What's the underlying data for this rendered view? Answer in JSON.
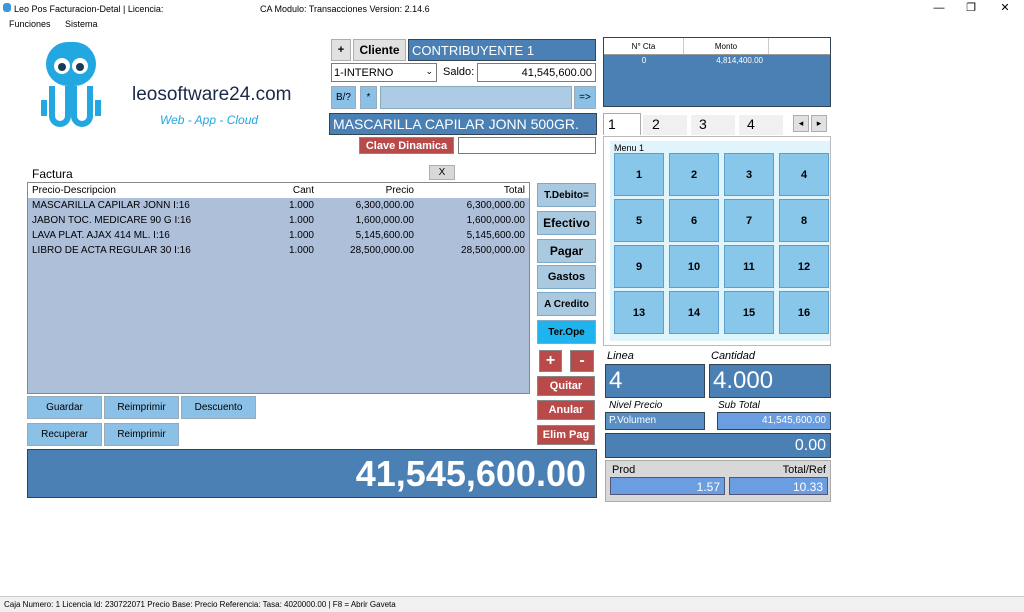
{
  "window": {
    "title": "Leo Pos Facturacion-Detal | Licencia:",
    "module": "CA Modulo: Transacciones Version:  2.14.6",
    "minimize": "—",
    "restore": "❐",
    "close": "✕"
  },
  "menu": [
    "Funciones",
    "Sistema"
  ],
  "logo": {
    "name": "leosoftware24.com",
    "tagline": "Web - App - Cloud"
  },
  "client": {
    "add_label": "+",
    "cliente_label": "Cliente",
    "name": "CONTRIBUYENTE 1",
    "type_selected": "1-INTERNO",
    "saldo_label": "Saldo:",
    "saldo_value": "41,545,600.00",
    "b_label": "B/?",
    "star_label": "*",
    "arrow_label": "=>",
    "product_display": "MASCARILLA CAPILAR JONN 500GR.",
    "clave_label": "Clave Dinamica"
  },
  "mini_table": {
    "headers": [
      "N° Cta",
      "Monto"
    ],
    "rows": [
      [
        "0",
        "4,814,400.00"
      ]
    ]
  },
  "tabs": [
    "1",
    "2",
    "3",
    "4"
  ],
  "tab_nav": {
    "prev": "◂",
    "next": "▸"
  },
  "menu_panel": {
    "title": "Menu 1",
    "buttons": [
      "1",
      "2",
      "3",
      "4",
      "5",
      "6",
      "7",
      "8",
      "9",
      "10",
      "11",
      "12",
      "13",
      "14",
      "15",
      "16"
    ]
  },
  "invoice": {
    "title": "Factura",
    "close_label": "X",
    "headers": [
      "Precio-Descripcion",
      "Cant",
      "Precio",
      "Total"
    ],
    "rows": [
      [
        "MASCARILLA CAPILAR JONN  I:16",
        "1.000",
        "6,300,000.00",
        "6,300,000.00"
      ],
      [
        "JABON TOC. MEDICARE 90 G I:16",
        "1.000",
        "1,600,000.00",
        "1,600,000.00"
      ],
      [
        "LAVA PLAT. AJAX 414 ML. I:16",
        "1.000",
        "5,145,600.00",
        "5,145,600.00"
      ],
      [
        "LIBRO DE ACTA REGULAR 30 I:16",
        "1.000",
        "28,500,000.00",
        "28,500,000.00"
      ]
    ]
  },
  "side_buttons": [
    "T.Debito=",
    "Efectivo",
    "Pagar",
    "Gastos",
    "A Credito",
    "Ter.Ope"
  ],
  "plus_label": "+",
  "minus_label": "-",
  "action_buttons": [
    "Quitar",
    "Anular",
    "Elim Pag"
  ],
  "bottom_buttons": {
    "guardar": "Guardar",
    "reimprimir1": "Reimprimir",
    "descuento": "Descuento",
    "recuperar": "Recuperar",
    "reimprimir2": "Reimprimir"
  },
  "total_display": "41,545,600.00",
  "right_panel": {
    "linea_label": "Linea",
    "linea_value": "4",
    "cantidad_label": "Cantidad",
    "cantidad_value": "4.000",
    "nivel_label": "Nivel Precio",
    "nivel_value": "P.Volumen",
    "subtotal_label": "Sub Total",
    "subtotal_value": "41,545,600.00",
    "discount_value": "0.00",
    "prod_label": "Prod",
    "prod_value": "1.57",
    "totalref_label": "Total/Ref",
    "totalref_value": "10.33"
  },
  "statusbar": "Caja Numero:  1  Licencia Id:  230722071  Precio Base:  Precio Referencia:  Tasa:  4020000.00  | F8 = Abrir Gaveta",
  "colors": {
    "dark_blue": "#4b80b5",
    "grid_bg": "#aebfda",
    "button_blue": "#8bc1e6",
    "red": "#b94a4a"
  }
}
